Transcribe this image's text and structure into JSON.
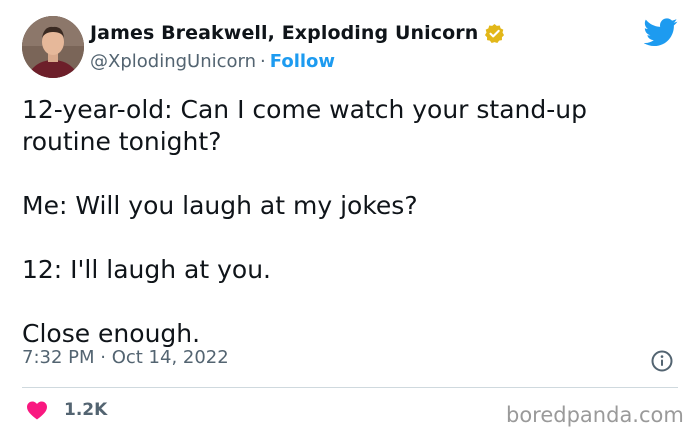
{
  "author": {
    "display_name": "James Breakwell, Exploding Unicorn",
    "handle": "@XplodingUnicorn",
    "separator": "·",
    "follow_label": "Follow"
  },
  "tweet": {
    "lines": [
      "12-year-old: Can I come watch your stand-up routine tonight?",
      "Me: Will you laugh at my jokes?",
      "12: I'll laugh at you.",
      "Close enough."
    ],
    "timestamp": "7:32 PM · Oct 14, 2022"
  },
  "engagement": {
    "like_count": "1.2K"
  },
  "watermark": "boredpanda.com",
  "icons": {
    "avatar": "avatar",
    "verified": "verified-badge-icon",
    "platform": "twitter-bird-icon",
    "info": "info-icon",
    "like": "heart-icon"
  },
  "colors": {
    "link": "#1d9bf0",
    "secondary_text": "#536471",
    "heart": "#f91880",
    "verified_gold": "#e2b719"
  }
}
